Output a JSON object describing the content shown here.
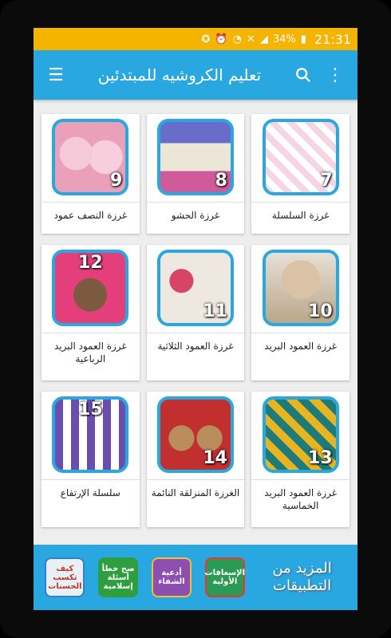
{
  "status_bar": {
    "battery": "34%",
    "time": "21:31"
  },
  "app_bar": {
    "title": "تعليم الكروشيه للمبتدئين"
  },
  "cards": [
    {
      "label": "غرزة النصف عمود",
      "number": "9"
    },
    {
      "label": "غرزة الحشو",
      "number": "8"
    },
    {
      "label": "غرزة السلسلة",
      "number": "7"
    },
    {
      "label": "غرزة العمود البريد الرباعية",
      "number": "12"
    },
    {
      "label": "غرزة العمود الثلاثية",
      "number": "11"
    },
    {
      "label": "غرزة العمود البريد",
      "number": "10"
    },
    {
      "label": "سلسلة الإرتفاع",
      "number": "15"
    },
    {
      "label": "الغرزة المنزلقة النائمة",
      "number": "14"
    },
    {
      "label": "غرزة العمود البريد الخماسية",
      "number": "13"
    }
  ],
  "bottom_bar": {
    "more_apps": "المزيد من التطبيقات",
    "apps": [
      {
        "name": "الإسعافات الأولية"
      },
      {
        "name": "أدعية الشفاء"
      },
      {
        "name": "صح خطأ أسئلة إسلامية"
      },
      {
        "name": "كيف تكسب الحسنات"
      }
    ]
  },
  "colors": {
    "status": "#f5b400",
    "primary": "#29a7e1"
  }
}
